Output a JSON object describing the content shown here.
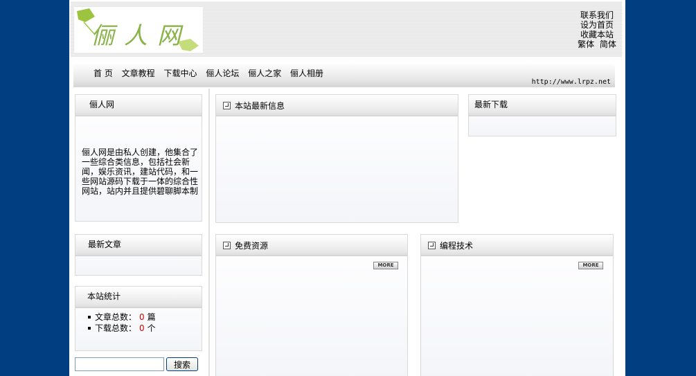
{
  "logo": {
    "text": "俪人网"
  },
  "header_links": {
    "contact": "联系我们",
    "set_home": "设为首页",
    "bookmark": "收藏本站",
    "traditional": "繁体",
    "simplified": "简体"
  },
  "nav": {
    "items": [
      "首 页",
      "文章教程",
      "下载中心",
      "俪人论坛",
      "俪人之家",
      "俪人相册"
    ],
    "url": "http://www.lrpz.net"
  },
  "sidebar": {
    "about": {
      "title": "俪人网",
      "text": "俪人网是由私人创建，他集合了一些综合类信息，包括社会新闻，娱乐资讯，建站代码，和一些网站源码下载于一体的综合性网站，站内并且提供碧聊脚本制"
    },
    "latest_articles": {
      "title": "最新文章"
    },
    "stats": {
      "title": "本站统计",
      "articles_label": "文章总数：",
      "articles_value": "0",
      "articles_unit": "篇",
      "downloads_label": "下载总数：",
      "downloads_value": "0",
      "downloads_unit": "个"
    },
    "search": {
      "button": "搜索",
      "value": ""
    }
  },
  "main": {
    "latest_info": {
      "title": "本站最新信息"
    },
    "latest_downloads": {
      "title": "最新下载"
    },
    "free_resources": {
      "title": "免费资源",
      "more": "MORE"
    },
    "programming": {
      "title": "编程技术",
      "more": "MORE"
    }
  }
}
